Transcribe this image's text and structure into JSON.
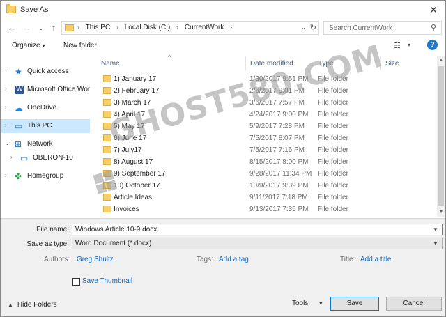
{
  "window": {
    "title": "Save As",
    "close_glyph": "✕"
  },
  "nav": {
    "back": "←",
    "forward": "→",
    "recent": "⌄",
    "up": "↑"
  },
  "address": {
    "crumbs": [
      "This PC",
      "Local Disk (C:)",
      "CurrentWork"
    ],
    "sep": "›",
    "drop": "⌄",
    "refresh": "↻"
  },
  "search": {
    "placeholder": "Search CurrentWork",
    "icon": "⚲"
  },
  "toolbar": {
    "organize": "Organize",
    "new_folder": "New folder",
    "caret": "▾",
    "view_icon": "☷",
    "help": "?"
  },
  "sidebar": {
    "items": [
      {
        "label": "Quick access",
        "icon": "★",
        "color": "#1979ca"
      },
      {
        "label": "Microsoft Office Wor",
        "icon": "W",
        "color": "#2b579a"
      },
      {
        "label": "OneDrive",
        "icon": "☁",
        "color": "#1e88e5"
      },
      {
        "label": "This PC",
        "icon": "▭",
        "color": "#1979ca"
      },
      {
        "label": "Network",
        "icon": "⊞",
        "color": "#1979ca"
      },
      {
        "label": "OBERON-10",
        "icon": "▭",
        "color": "#1979ca"
      },
      {
        "label": "Homegroup",
        "icon": "✤",
        "color": "#2aa24a"
      }
    ]
  },
  "columns": {
    "name": "Name",
    "date": "Date modified",
    "type": "Type",
    "size": "Size",
    "sort_arrow": "^"
  },
  "files": [
    {
      "name": "1) January 17",
      "date": "1/30/2017 9:51 PM",
      "type": "File folder"
    },
    {
      "name": "2) February 17",
      "date": "2/6/2017 9:01 PM",
      "type": "File folder"
    },
    {
      "name": "3) March 17",
      "date": "3/6/2017 7:57 PM",
      "type": "File folder"
    },
    {
      "name": "4) April 17",
      "date": "4/24/2017 9:00 PM",
      "type": "File folder"
    },
    {
      "name": "5) May 17",
      "date": "5/9/2017 7:28 PM",
      "type": "File folder"
    },
    {
      "name": "6) June 17",
      "date": "7/5/2017 8:07 PM",
      "type": "File folder"
    },
    {
      "name": "7) July17",
      "date": "7/5/2017 7:16 PM",
      "type": "File folder"
    },
    {
      "name": "8) August 17",
      "date": "8/15/2017 8:00 PM",
      "type": "File folder"
    },
    {
      "name": "9) September 17",
      "date": "9/28/2017 11:34 PM",
      "type": "File folder"
    },
    {
      "name": "10) October 17",
      "date": "10/9/2017 9:39 PM",
      "type": "File folder"
    },
    {
      "name": "Article Ideas",
      "date": "9/11/2017 7:18 PM",
      "type": "File folder"
    },
    {
      "name": "Invoices",
      "date": "9/13/2017 7:35 PM",
      "type": "File folder"
    }
  ],
  "watermark": "GHOST580.COM",
  "form": {
    "file_name_label": "File name:",
    "file_name_value": "Windows Article 10-9.docx",
    "save_type_label": "Save as type:",
    "save_type_value": "Word Document (*.docx)",
    "authors_label": "Authors:",
    "authors_value": "Greg Shultz",
    "tags_label": "Tags:",
    "tags_value": "Add a tag",
    "title_label": "Title:",
    "title_value": "Add a title",
    "thumbnail_label": "Save Thumbnail",
    "drop": "⌄"
  },
  "footer": {
    "hide_folders": "Hide Folders",
    "tools": "Tools",
    "save": "Save",
    "cancel": "Cancel",
    "caret_up": "▲",
    "caret_down": "▼"
  }
}
